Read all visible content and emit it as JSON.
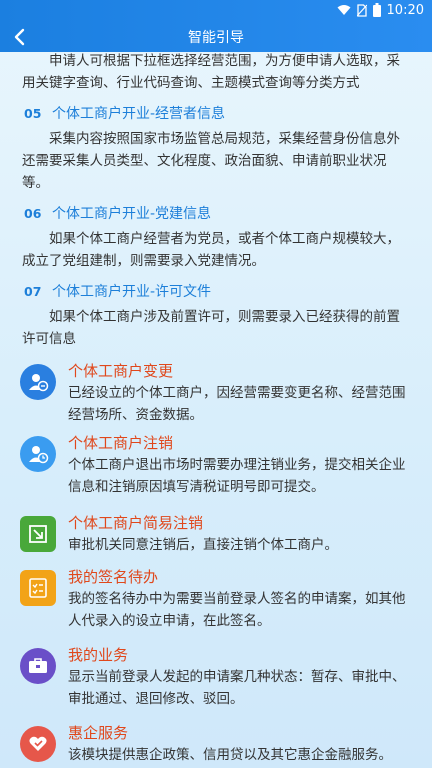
{
  "status": {
    "time": "10:20"
  },
  "header": {
    "title": "智能引导"
  },
  "intro": {
    "text": "申请人可根据下拉框选择经营范围，为方便申请人选取，采用关键字查询、行业代码查询、主题模式查询等分类方式"
  },
  "sections": [
    {
      "num": "05",
      "title": "个体工商户开业-经营者信息",
      "text": "采集内容按照国家市场监管总局规范，采集经营身份信息外还需要采集人员类型、文化程度、政治面貌、申请前职业状况等。"
    },
    {
      "num": "06",
      "title": "个体工商户开业-党建信息",
      "text": "如果个体工商户经营者为党员，或者个体工商户规模较大，成立了党组建制，则需要录入党建情况。"
    },
    {
      "num": "07",
      "title": "个体工商户开业-许可文件",
      "text": "如果个体工商户涉及前置许可，则需要录入已经获得的前置许可信息"
    }
  ],
  "cards": [
    {
      "icon": "user-change-icon",
      "color": "#2a7fe0",
      "title": "个体工商户变更",
      "desc": "已经设立的个体工商户，因经营需要变更名称、经营范围经营场所、资金数据。"
    },
    {
      "icon": "user-cancel-icon",
      "color": "#3a9cf0",
      "title": "个体工商户注销",
      "desc": "个体工商户退出市场时需要办理注销业务，提交相关企业信息和注销原因填写清税证明号即可提交。"
    },
    {
      "icon": "simple-cancel-icon",
      "color": "#49a83a",
      "title": "个体工商户简易注销",
      "desc": "审批机关同意注销后，直接注销个体工商户。"
    },
    {
      "icon": "signature-todo-icon",
      "color": "#f2a317",
      "title": "我的签名待办",
      "desc": "我的签名待办中为需要当前登录人签名的申请案，如其他人代录入的设立申请，在此签名。"
    },
    {
      "icon": "briefcase-icon",
      "color": "#6a4fc8",
      "title": "我的业务",
      "desc": "显示当前登录人发起的申请案几种状态：暂存、审批中、审批通过、退回修改、驳回。"
    },
    {
      "icon": "heart-hand-icon",
      "color": "#e6574a",
      "title": "惠企服务",
      "desc": "该模块提供惠企政策、信用贷以及其它惠企金融服务。"
    }
  ]
}
